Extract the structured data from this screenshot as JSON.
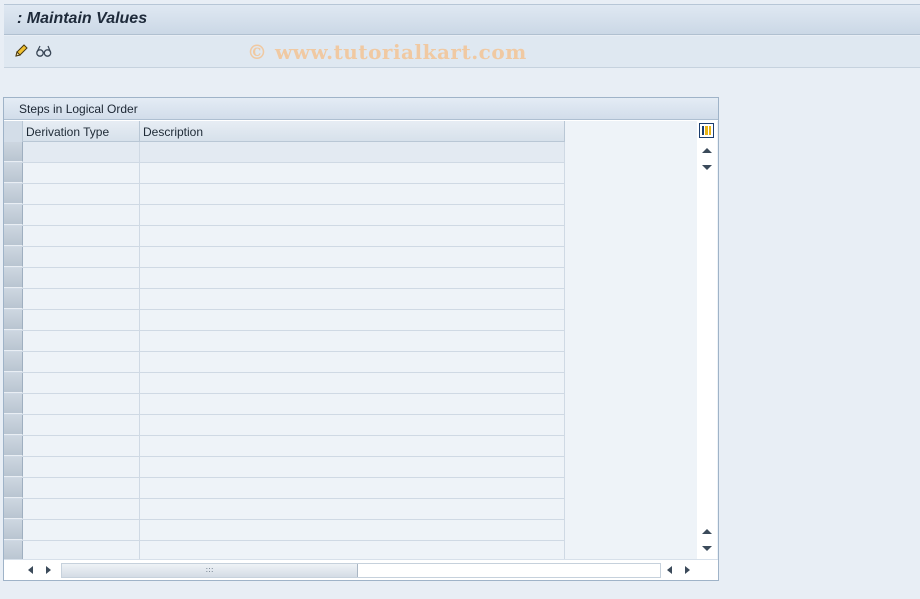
{
  "window": {
    "title": ": Maintain Values"
  },
  "toolbar": {
    "items": [
      {
        "icon": "pencil-icon",
        "label": "Change"
      },
      {
        "icon": "glasses-icon",
        "label": "Display"
      }
    ],
    "watermark": "© www.tutorialkart.com"
  },
  "table": {
    "title": "Steps in Logical Order",
    "columns": [
      {
        "label": "Derivation Type"
      },
      {
        "label": "Description"
      }
    ],
    "row_count": 20,
    "rows": []
  },
  "colors": {
    "background": "#e8eef5",
    "title_text": "#1e2a3a",
    "watermark": "#f0c9a2",
    "accent": "#1b3d6e"
  }
}
